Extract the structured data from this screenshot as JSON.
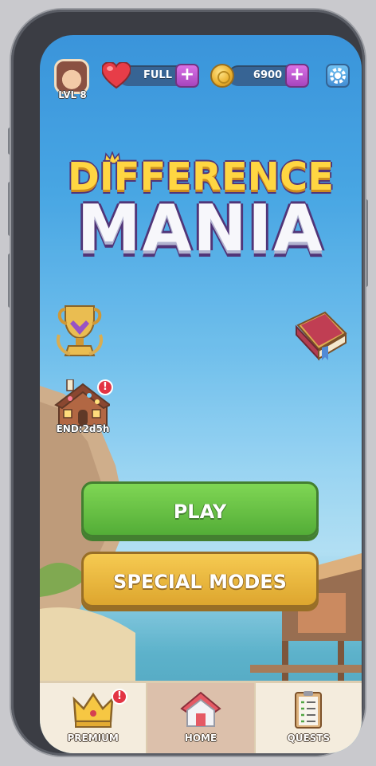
{
  "status_bar": {
    "level": "LVL 8",
    "lives_label": "FULL",
    "coins": "6900",
    "plus_symbol": "+"
  },
  "logo": {
    "line1": "DIFFERENCE",
    "line2": "MANIA"
  },
  "events": {
    "house_timer": "END:2d5h",
    "badge_symbol": "!"
  },
  "buttons": {
    "play": "PLAY",
    "special_modes": "SPECIAL MODES"
  },
  "nav": {
    "items": [
      {
        "label": "PREMIUM"
      },
      {
        "label": "HOME"
      },
      {
        "label": "QUESTS"
      }
    ]
  },
  "colors": {
    "play_green": "#4cb826",
    "special_gold": "#e5ad20",
    "accent_purple": "#b33fce",
    "badge_red": "#e0182b"
  }
}
